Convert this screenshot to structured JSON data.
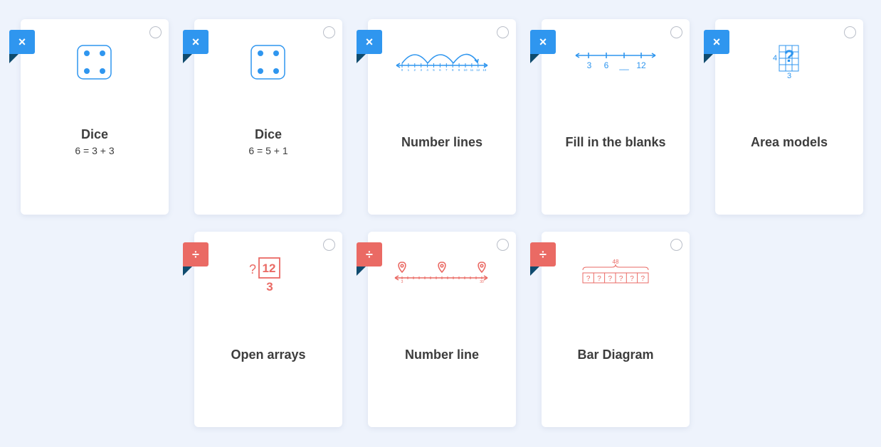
{
  "cards": [
    {
      "title": "Dice",
      "subtitle": "6 = 3 + 3",
      "flag_symbol": "×",
      "icon": "dice-four-icon"
    },
    {
      "title": "Dice",
      "subtitle": "6 = 5 + 1",
      "flag_symbol": "×",
      "icon": "dice-four-icon"
    },
    {
      "title": "Number lines",
      "flag_symbol": "×",
      "icon": "number-line-jumps-icon",
      "ticks": [
        "0",
        "1",
        "2",
        "3",
        "4",
        "5",
        "6",
        "7",
        "8",
        "9",
        "10",
        "11",
        "12",
        "13"
      ]
    },
    {
      "title": "Fill in the blanks",
      "flag_symbol": "×",
      "icon": "number-line-blanks-icon",
      "labels": [
        "3",
        "6",
        "__",
        "12"
      ]
    },
    {
      "title": "Area models",
      "flag_symbol": "×",
      "icon": "area-model-icon",
      "labels": [
        "4",
        "?",
        "3"
      ]
    },
    {
      "title": "Open arrays",
      "flag_symbol": "÷",
      "icon": "open-array-icon",
      "labels": [
        "?",
        "12",
        "3"
      ]
    },
    {
      "title": "Number line",
      "flag_symbol": "÷",
      "icon": "number-line-pins-icon",
      "labels": [
        "3",
        "30"
      ]
    },
    {
      "title": "Bar Diagram",
      "flag_symbol": "÷",
      "icon": "bar-diagram-icon",
      "labels": [
        "48",
        "?",
        "?",
        "?",
        "?",
        "?",
        "?"
      ]
    }
  ],
  "colors": {
    "blue": "#2f96ef",
    "red": "#ea6a64",
    "fold": "#0f4b6e",
    "background": "#eef3fc"
  }
}
